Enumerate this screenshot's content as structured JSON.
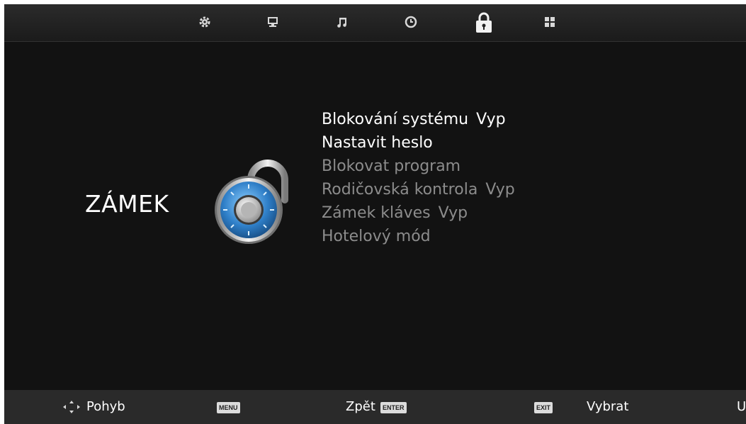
{
  "top_tabs": [
    {
      "icon": "gear-icon"
    },
    {
      "icon": "monitor-icon"
    },
    {
      "icon": "music-note-icon"
    },
    {
      "icon": "clock-icon"
    },
    {
      "icon": "lock-icon",
      "active": true
    },
    {
      "icon": "apps-grid-icon"
    }
  ],
  "section": {
    "title": "ZÁMEK",
    "icon": "combination-lock-icon"
  },
  "menu": {
    "items": [
      {
        "label": "Blokování systému",
        "value": "Vyp",
        "enabled": true
      },
      {
        "label": "Nastavit heslo",
        "value": "",
        "enabled": true
      },
      {
        "label": "Blokovat program",
        "value": "",
        "enabled": false
      },
      {
        "label": "Rodičovská kontrola",
        "value": "Vyp",
        "enabled": false
      },
      {
        "label": "Zámek kláves",
        "value": "Vyp",
        "enabled": false
      },
      {
        "label": "Hotelový mód",
        "value": "",
        "enabled": false
      }
    ]
  },
  "bottom_bar": {
    "move_label": "Pohyb",
    "menu_key": "MENU",
    "back_label": "Zpět",
    "enter_key": "ENTER",
    "exit_key": "EXIT",
    "select_label": "Vybrat",
    "cut_label": "U"
  },
  "colors": {
    "background": "#121212",
    "bar": "#2a2a2a",
    "enabled_text": "#ffffff",
    "disabled_text": "#8c8c8c",
    "lock_blue": "#2f7fc8"
  }
}
